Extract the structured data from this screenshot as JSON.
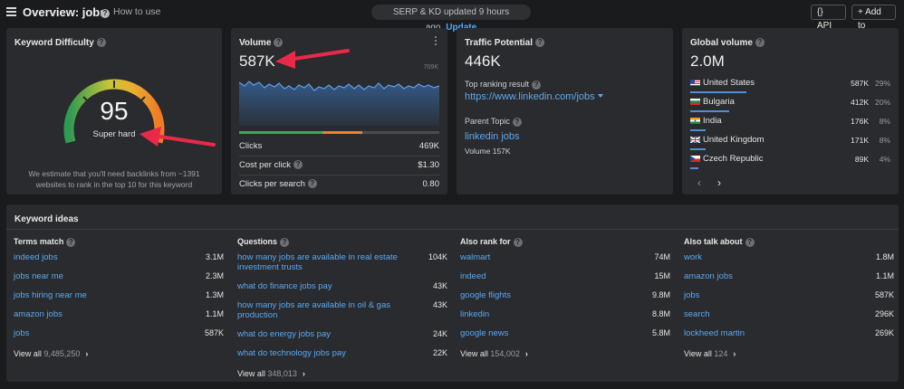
{
  "header": {
    "title": "Overview: jobs",
    "how_to": "How to use",
    "update_text": "SERP & KD updated 9 hours ago.",
    "update_link": "Update",
    "api_label": "API",
    "add_label": "Add to"
  },
  "kd": {
    "title": "Keyword Difficulty",
    "score": "95",
    "label": "Super hard",
    "note": "We estimate that you'll need backlinks from ~1391 websites to rank in the top 10 for this keyword"
  },
  "volume": {
    "title": "Volume",
    "value": "587K",
    "spark_max": "709K",
    "rows": [
      {
        "label": "Clicks",
        "value": "469K",
        "help": false
      },
      {
        "label": "Cost per click",
        "value": "$1.30",
        "help": true
      },
      {
        "label": "Clicks per search",
        "value": "0.80",
        "help": true
      }
    ]
  },
  "traffic": {
    "title": "Traffic Potential",
    "value": "446K",
    "top_label": "Top ranking result",
    "top_url": "https://www.linkedin.com/jobs",
    "parent_label": "Parent Topic",
    "parent_link": "linkedin jobs",
    "parent_volume": "Volume 157K"
  },
  "global": {
    "title": "Global volume",
    "value": "2.0M",
    "countries": [
      {
        "name": "United States",
        "value": "587K",
        "pct": "29%",
        "share": 0.29
      },
      {
        "name": "Bulgaria",
        "value": "412K",
        "pct": "20%",
        "share": 0.2
      },
      {
        "name": "India",
        "value": "176K",
        "pct": "8%",
        "share": 0.08
      },
      {
        "name": "United Kingdom",
        "value": "171K",
        "pct": "8%",
        "share": 0.08
      },
      {
        "name": "Czech Republic",
        "value": "89K",
        "pct": "4%",
        "share": 0.04
      }
    ],
    "prev": "‹",
    "next": "›"
  },
  "ideas": {
    "title": "Keyword ideas",
    "columns": [
      {
        "head": "Terms match",
        "rows": [
          {
            "kw": "indeed jobs",
            "v": "3.1M"
          },
          {
            "kw": "jobs near me",
            "v": "2.3M"
          },
          {
            "kw": "jobs hiring near me",
            "v": "1.3M"
          },
          {
            "kw": "amazon jobs",
            "v": "1.1M"
          },
          {
            "kw": "jobs",
            "v": "587K"
          }
        ],
        "view_all": "View all",
        "count": "9,485,250"
      },
      {
        "head": "Questions",
        "rows": [
          {
            "kw": "how many jobs are available in real estate investment trusts",
            "v": "104K"
          },
          {
            "kw": "what do finance jobs pay",
            "v": "43K"
          },
          {
            "kw": "how many jobs are available in oil & gas production",
            "v": "43K"
          },
          {
            "kw": "what do energy jobs pay",
            "v": "24K"
          },
          {
            "kw": "what do technology jobs pay",
            "v": "22K"
          }
        ],
        "view_all": "View all",
        "count": "348,013"
      },
      {
        "head": "Also rank for",
        "rows": [
          {
            "kw": "walmart",
            "v": "74M"
          },
          {
            "kw": "indeed",
            "v": "15M"
          },
          {
            "kw": "google flights",
            "v": "9.8M"
          },
          {
            "kw": "linkedin",
            "v": "8.8M"
          },
          {
            "kw": "google news",
            "v": "5.8M"
          }
        ],
        "view_all": "View all",
        "count": "154,002"
      },
      {
        "head": "Also talk about",
        "rows": [
          {
            "kw": "work",
            "v": "1.8M"
          },
          {
            "kw": "amazon jobs",
            "v": "1.1M"
          },
          {
            "kw": "jobs",
            "v": "587K"
          },
          {
            "kw": "search",
            "v": "296K"
          },
          {
            "kw": "lockheed martin",
            "v": "269K"
          }
        ],
        "view_all": "View all",
        "count": "124"
      }
    ]
  },
  "colors": {
    "background": "#1a1b1d",
    "card": "#2a2b2e",
    "link": "#5aa9f2",
    "annotation_arrow": "#e8294a",
    "gauge_green": "#36a85a",
    "gauge_orange": "#f07f28"
  }
}
